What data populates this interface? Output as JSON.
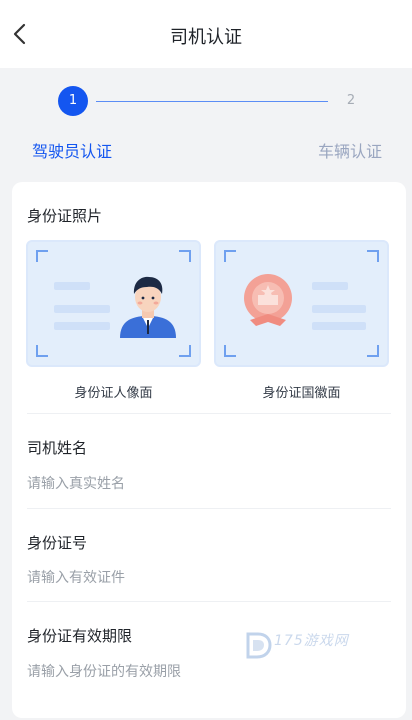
{
  "header": {
    "title": "司机认证",
    "back_icon": "chevron-left-icon"
  },
  "stepper": {
    "steps": [
      {
        "number": "1",
        "label": "驾驶员认证",
        "active": true
      },
      {
        "number": "2",
        "label": "车辆认证",
        "active": false
      }
    ],
    "active_color": "#1456f0",
    "inactive_color": "#9aa6c0"
  },
  "id_photos": {
    "title": "身份证照片",
    "front_caption": "身份证人像面",
    "back_caption": "身份证国徽面"
  },
  "form": {
    "name": {
      "label": "司机姓名",
      "placeholder": "请输入真实姓名"
    },
    "id_number": {
      "label": "身份证号",
      "placeholder": "请输入有效证件"
    },
    "id_validity": {
      "label": "身份证有效期限",
      "placeholder": "请输入身份证的有效期限"
    }
  },
  "watermark": {
    "text": "175游戏网"
  }
}
